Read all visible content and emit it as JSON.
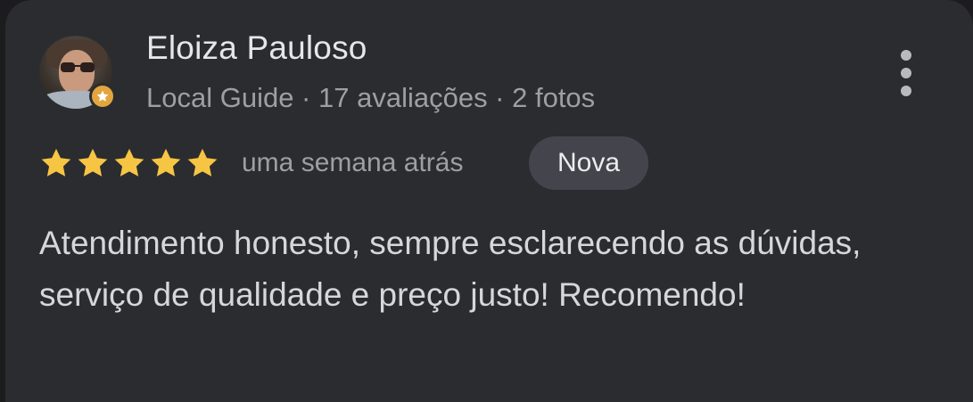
{
  "review": {
    "author_name": "Eloiza Pauloso",
    "author_meta": "Local Guide · 17 avaliações · 2 fotos",
    "rating": 5,
    "rating_max": 5,
    "time_ago": "uma semana atrás",
    "badge": "Nova",
    "text": "Atendimento honesto, sempre esclarecendo as dúvidas, serviço de qualidade e preço justo! Recomendo!"
  },
  "icons": {
    "star": "star-icon",
    "menu": "more-vert-icon",
    "guide_badge": "local-guide-star-icon"
  },
  "colors": {
    "star": "#f6c543",
    "card_background": "#2b2c30",
    "chip_background": "#44454c",
    "guide_badge": "#e3a53d"
  }
}
